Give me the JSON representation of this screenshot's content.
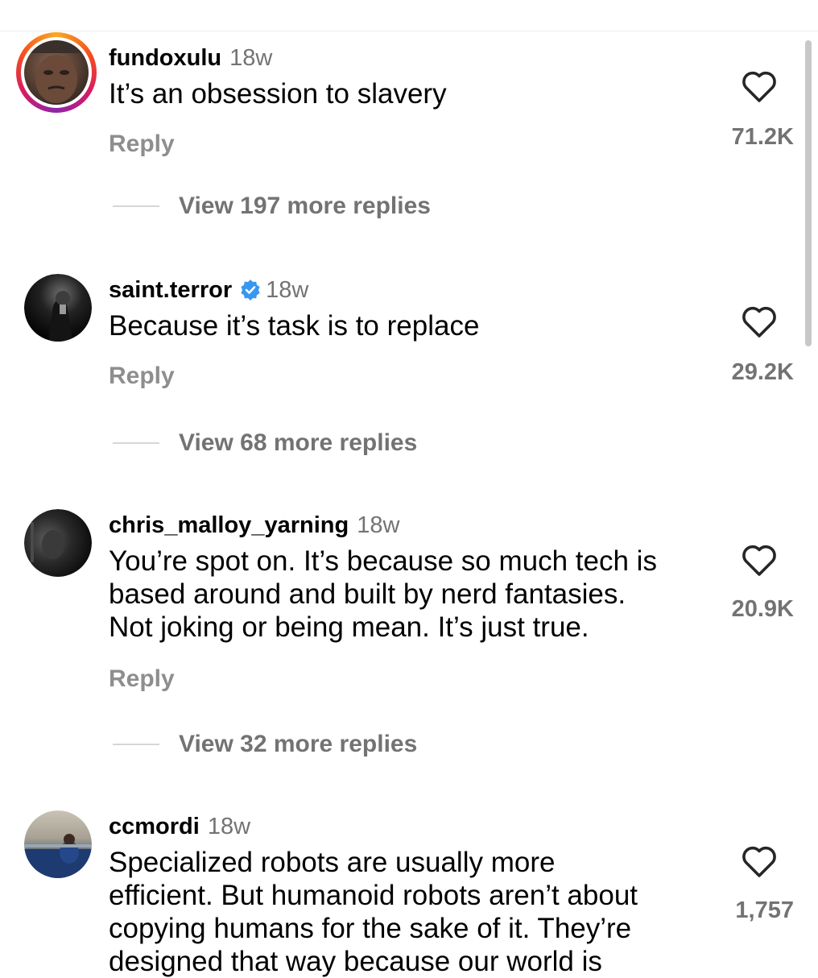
{
  "comments": [
    {
      "username": "fundoxulu",
      "time": "18w",
      "text": "It’s an obsession to slavery",
      "reply_label": "Reply",
      "likes": "71.2K",
      "view_replies": "View 197 more replies",
      "verified": false,
      "avatar_has_story_ring": true
    },
    {
      "username": "saint.terror",
      "time": "18w",
      "text": "Because it’s task is to replace",
      "reply_label": "Reply",
      "likes": "29.2K",
      "view_replies": "View 68 more replies",
      "verified": true
    },
    {
      "username": "chris_malloy_yarning",
      "time": "18w",
      "text_lines": [
        "You’re spot on. It’s because so much tech is",
        "based around and built by nerd fantasies.",
        "Not joking or being mean. It’s just true."
      ],
      "reply_label": "Reply",
      "likes": "20.9K",
      "view_replies": "View 32 more replies",
      "verified": false
    },
    {
      "username": "ccmordi",
      "time": "18w",
      "text_lines": [
        "Specialized robots are usually more",
        "efficient. But humanoid robots aren’t about",
        "copying humans for the sake of it. They’re",
        "designed that way because our world is"
      ],
      "likes": "1,757",
      "verified": false
    }
  ],
  "colors": {
    "username": "#000000",
    "secondary_text": "#737373",
    "verified_badge": "#3897f0",
    "divider": "#d6d6d6"
  },
  "icons": {
    "like": "heart-outline-icon",
    "verified": "verified-badge-icon"
  }
}
